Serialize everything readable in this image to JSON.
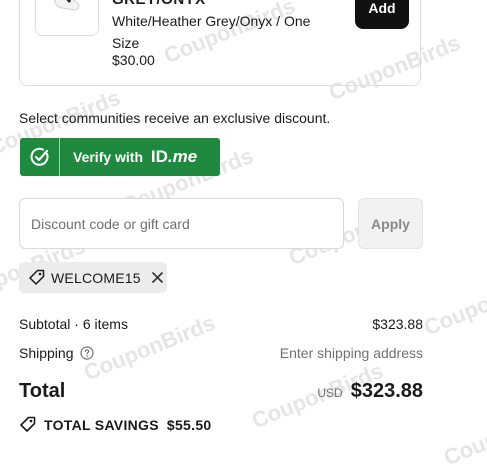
{
  "product": {
    "title": "GREY/ONYX",
    "variant": "White/Heather Grey/Onyx / One Size",
    "price": "$30.00",
    "add_label": "Add"
  },
  "discount": {
    "community_text": "Select communities receive an exclusive discount.",
    "idme_label": "Verify with",
    "idme_brand_id": "ID",
    "idme_brand_me": ".me",
    "input_placeholder": "Discount code or gift card",
    "apply_label": "Apply",
    "applied_code": "WELCOME15"
  },
  "summary": {
    "subtotal_label": "Subtotal · 6 items",
    "subtotal_value": "$323.88",
    "shipping_label": "Shipping",
    "shipping_value": "Enter shipping address",
    "total_label": "Total",
    "currency": "USD",
    "total_value": "$323.88",
    "savings_label": "TOTAL SAVINGS",
    "savings_value": "$55.50"
  },
  "watermark": "CouponBirds",
  "colors": {
    "idme_green": "#1f8a3f",
    "add_button": "#111111",
    "muted_text": "#707070"
  }
}
